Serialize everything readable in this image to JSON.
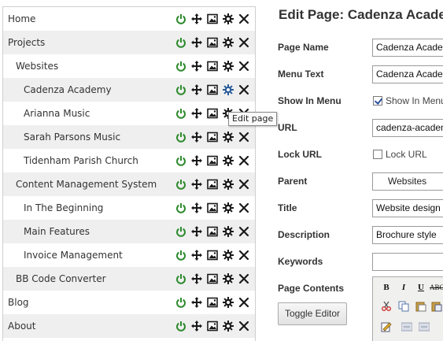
{
  "tree": {
    "items": [
      {
        "label": "Home",
        "level": 0
      },
      {
        "label": "Projects",
        "level": 0
      },
      {
        "label": "Websites",
        "level": 1
      },
      {
        "label": "Cadenza Academy",
        "level": 2
      },
      {
        "label": "Arianna Music",
        "level": 2
      },
      {
        "label": "Sarah Parsons Music",
        "level": 2
      },
      {
        "label": "Tidenham Parish Church",
        "level": 2
      },
      {
        "label": "Content Management System",
        "level": 1
      },
      {
        "label": "In The Beginning",
        "level": 2
      },
      {
        "label": "Main Features",
        "level": 2
      },
      {
        "label": "Invoice Management",
        "level": 2
      },
      {
        "label": "BB Code Converter",
        "level": 1
      },
      {
        "label": "Blog",
        "level": 0
      },
      {
        "label": "About",
        "level": 0
      }
    ],
    "action_icons": [
      "power-icon",
      "move-icon",
      "image-icon",
      "gear-icon",
      "close-icon"
    ],
    "tooltip": "Edit page"
  },
  "form": {
    "title": "Edit Page: Cadenza Academy",
    "page_name_label": "Page Name",
    "page_name_value": "Cadenza Academy",
    "menu_text_label": "Menu Text",
    "menu_text_value": "Cadenza Academy",
    "show_in_menu_label": "Show In Menu",
    "show_in_menu_text": "Show In Menu",
    "url_label": "URL",
    "url_value": "cadenza-academy",
    "lock_url_label": "Lock URL",
    "lock_url_text": "Lock URL",
    "parent_label": "Parent",
    "parent_value": "Websites",
    "title_label": "Title",
    "title_value": "Website design",
    "description_label": "Description",
    "description_value": "Brochure style",
    "keywords_label": "Keywords",
    "keywords_value": "",
    "page_contents_label": "Page Contents",
    "toggle_editor_label": "Toggle Editor"
  },
  "editor_toolbar": {
    "bold": "B",
    "italic": "I",
    "underline": "U",
    "strike": "ABC"
  },
  "colors": {
    "power": "#2e8b2e",
    "icon": "#1a1a1a",
    "gear_active": "#2a5c9a",
    "row_shade": "#efefef"
  }
}
